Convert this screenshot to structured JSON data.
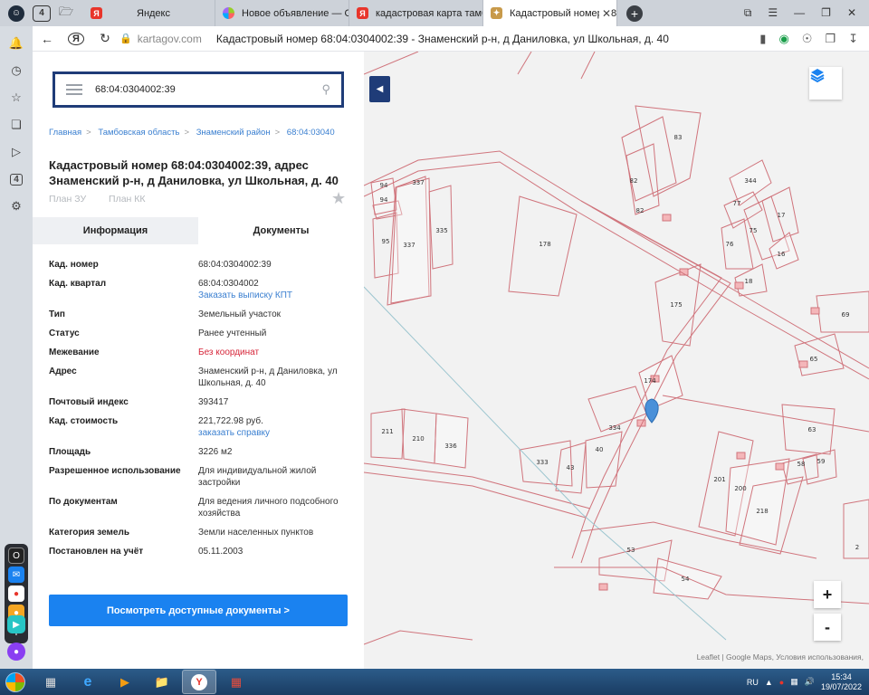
{
  "browser": {
    "tabs": [
      {
        "label": "Яндекс",
        "favicon": "yandex-icon"
      },
      {
        "label": "Новое объявление — Об",
        "favicon": "avito-icon"
      },
      {
        "label": "кадастровая карта тамбов",
        "favicon": "yandex-icon"
      },
      {
        "label": "Кадастровый номер 68",
        "favicon": "kartagov-icon",
        "active": true
      }
    ],
    "domain": "kartagov.com",
    "page_title": "Кадастровый номер 68:04:0304002:39 - Знаменский р-н, д Даниловка, ул Школьная, д. 40",
    "tab_count_badge": "4",
    "rail_badge": "4"
  },
  "panel": {
    "search_value": "68:04:0304002:39",
    "breadcrumbs": [
      "Главная",
      "Тамбовская область",
      "Знаменский район",
      "68:04:03040"
    ],
    "title": "Кадастровый номер 68:04:0304002:39, адрес Знаменский р-н, д Даниловка, ул Школьная, д. 40",
    "plans": [
      "План ЗУ",
      "План КК"
    ],
    "tabs": [
      "Информация",
      "Документы"
    ],
    "rows": [
      {
        "k": "Кад. номер",
        "v": "68:04:0304002:39"
      },
      {
        "k": "Кад. квартал",
        "v": "68:04:0304002",
        "link": "Заказать выписку КПТ"
      },
      {
        "k": "Тип",
        "v": "Земельный участок"
      },
      {
        "k": "Статус",
        "v": "Ранее учтенный"
      },
      {
        "k": "Межевание",
        "v": "Без координат",
        "red": true
      },
      {
        "k": "Адрес",
        "v": "Знаменский р-н, д Даниловка, ул Школьная, д. 40"
      },
      {
        "k": "Почтовый индекс",
        "v": "393417"
      },
      {
        "k": "Кад. стоимость",
        "v": "221,722.98 руб.",
        "link": "заказать справку"
      },
      {
        "k": "Площадь",
        "v": "3226 м2"
      },
      {
        "k": "Разрешенное использование",
        "v": "Для индивидуальной жилой застройки"
      },
      {
        "k": "По документам",
        "v": "Для ведения личного подсобного хозяйства"
      },
      {
        "k": "Категория земель",
        "v": "Земли населенных пунктов"
      },
      {
        "k": "Постановлен на учёт",
        "v": "05.11.2003"
      }
    ],
    "docs_button": "Посмотреть доступные документы >"
  },
  "map": {
    "parcel_labels": [
      "94",
      "94",
      "337",
      "335",
      "95",
      "337",
      "178",
      "82",
      "82",
      "83",
      "344",
      "77",
      "76",
      "75",
      "17",
      "16",
      "18",
      "175",
      "69",
      "65",
      "174",
      "334",
      "63",
      "211",
      "210",
      "336",
      "333",
      "43",
      "40",
      "201",
      "200",
      "58",
      "59",
      "218",
      "53",
      "54",
      "2"
    ],
    "attribution": "Leaflet | Google Maps, Условия использования,",
    "zoom_in": "+",
    "zoom_out": "-",
    "parcel_color": "#d0747c",
    "marker_color": "#4a90d9"
  },
  "taskbar": {
    "lang": "RU",
    "time": "15:34",
    "date": "19/07/2022"
  }
}
